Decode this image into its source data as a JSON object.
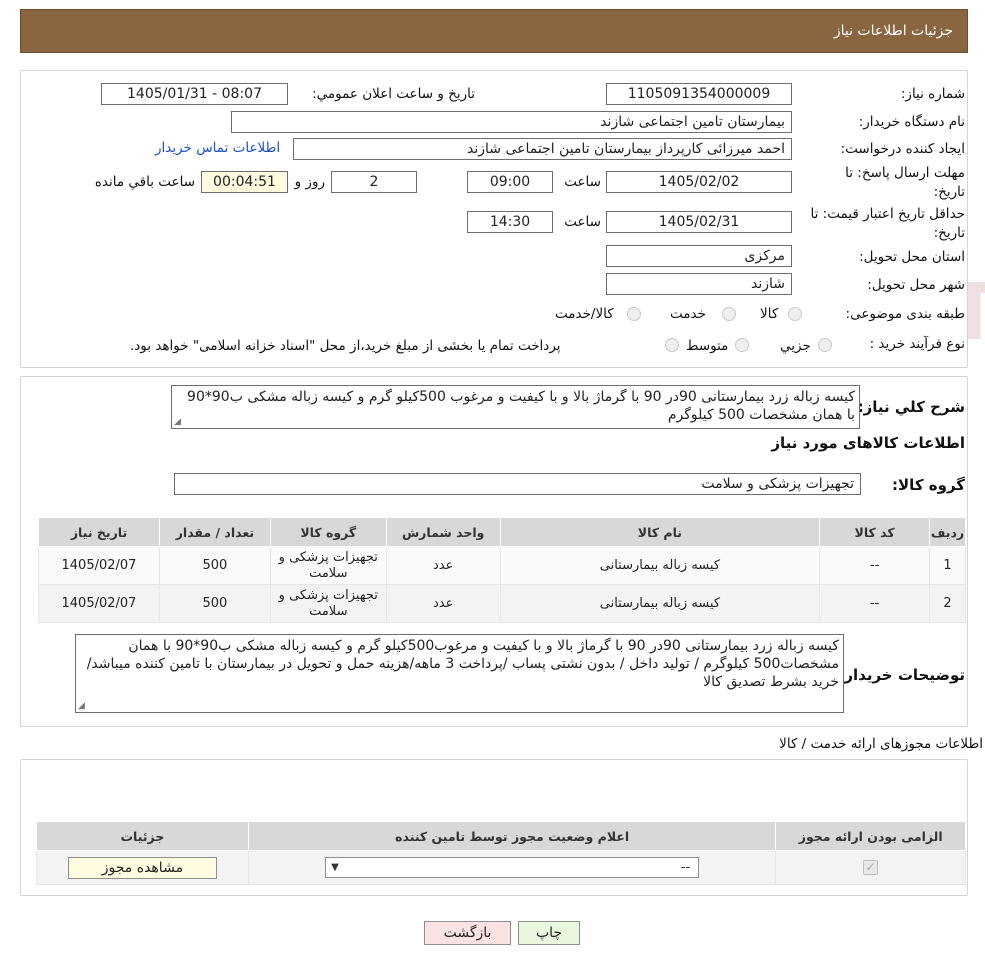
{
  "header": {
    "title": "جزئیات اطلاعات نیاز"
  },
  "watermark": {
    "text": "AriaTender.neT"
  },
  "info": {
    "need_number_label": "شماره نیاز:",
    "need_number": "1105091354000009",
    "announce_label": "تاریخ و ساعت اعلان عمومي:",
    "announce_value": "1405/01/31 - 08:07",
    "buyer_org_label": "نام دستگاه خریدار:",
    "buyer_org": "بیمارستان تامین اجتماعی شازند",
    "requester_label": "ایجاد کننده درخواست:",
    "requester": "احمد میرزائی کارپرداز بیمارستان تامین اجتماعی شازند",
    "contact_link": "اطلاعات تماس خریدار",
    "deadline_label_1": "مهلت ارسال پاسخ: تا",
    "deadline_label_2": "تاریخ:",
    "deadline_date": "1405/02/02",
    "time_label": "ساعت",
    "deadline_time": "09:00",
    "days_value": "2",
    "days_label": "روز و",
    "remaining_time": "00:04:51",
    "remaining_label": "ساعت باقي مانده",
    "validity_label_1": "حداقل تاریخ اعتبار قیمت: تا",
    "validity_label_2": "تاریخ:",
    "validity_date": "1405/02/31",
    "validity_time": "14:30",
    "province_label": "استان محل تحویل:",
    "province": "مرکزی",
    "city_label": "شهر محل تحویل:",
    "city": "شازند",
    "category_label": "طبقه بندی موضوعی:",
    "category_options": [
      "کالا",
      "خدمت",
      "کالا/خدمت"
    ],
    "purchase_type_label": "نوع فرآیند خرید :",
    "purchase_options": [
      "جزیي",
      "متوسط"
    ],
    "purchase_note": "پرداخت تمام یا بخشی از مبلغ خرید،از محل \"اسناد خزانه اسلامی\" خواهد بود."
  },
  "description": {
    "label": "شرح کلي نیاز:",
    "text": "کیسه زباله زرد بیمارستانی 90در 90 با گرماژ بالا و با کیفیت و مرغوب 500کیلو گرم و کیسه زباله مشکی ب90*90 با همان مشخصات 500 کیلوگرم"
  },
  "goods": {
    "section_title": "اطلاعات کالاهای مورد نیاز",
    "group_label": "گروه کالا:",
    "group_value": "تجهیزات پزشکی و سلامت",
    "columns": [
      "ردیف",
      "کد کالا",
      "نام کالا",
      "واحد شمارش",
      "گروه کالا",
      "تعداد / مقدار",
      "تاریخ نیاز"
    ],
    "rows": [
      {
        "row": "1",
        "code": "--",
        "name": "کیسه زباله بیمارستانی",
        "unit": "عدد",
        "group": "تجهیزات پزشکی و سلامت",
        "qty": "500",
        "date": "1405/02/07"
      },
      {
        "row": "2",
        "code": "--",
        "name": "کیسه زباله بیمارستانی",
        "unit": "عدد",
        "group": "تجهیزات پزشکی و سلامت",
        "qty": "500",
        "date": "1405/02/07"
      }
    ]
  },
  "buyer_notes": {
    "label": "توضیحات خریدار:",
    "text": "کیسه زباله زرد بیمارستانی 90در 90 با گرماژ بالا و با کیفیت و مرغوب500کیلو گرم و کیسه زباله مشکی ب90*90 با همان مشخصات500 کیلوگرم / تولید داخل / بدون نشتی پساب /پرداخت 3 ماهه/هزینه حمل و تحویل در بیمارستان با تامین کننده میباشد/خرید بشرط تصدیق کالا"
  },
  "permits": {
    "section_title": "اطلاعات مجوزهای ارائه خدمت / کالا",
    "columns": [
      "الزامی بودن ارائه مجوز",
      "اعلام وضعیت مجوز توسط تامین کننده",
      "جزئیات"
    ],
    "status_value": "--",
    "view_button": "مشاهده مجوز"
  },
  "actions": {
    "print": "چاپ",
    "back": "بازگشت"
  }
}
